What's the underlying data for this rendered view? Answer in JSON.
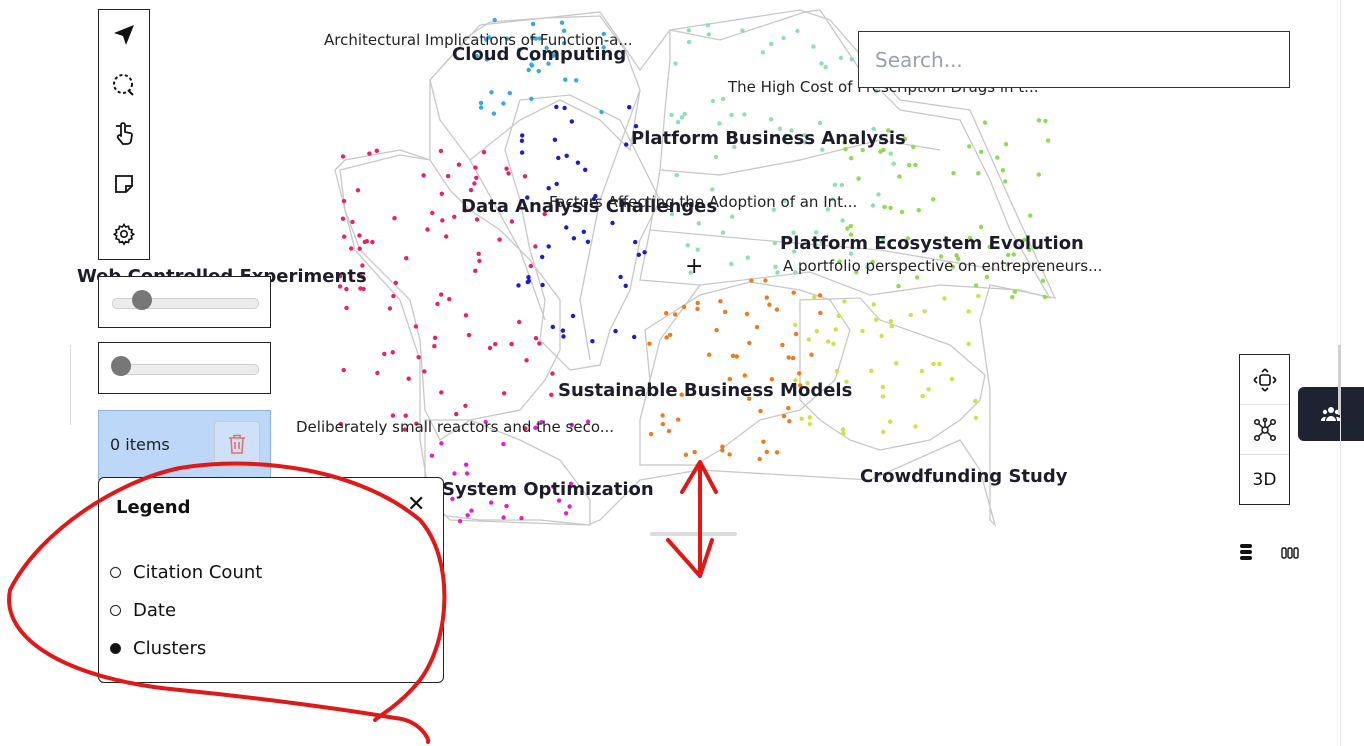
{
  "search": {
    "placeholder": "Search..."
  },
  "clusters": [
    {
      "name": "Cloud Computing",
      "color": "#3aa8e0"
    },
    {
      "name": "Platform Business Analysis",
      "color": "#8ee0b4"
    },
    {
      "name": "Data Analysis Challenges",
      "color": "#1e1ad0"
    },
    {
      "name": "Web Controlled Experiments",
      "color": "#e8206a"
    },
    {
      "name": "Platform Ecosystem Evolution",
      "color": "#8ddb4f"
    },
    {
      "name": "Sustainable Business Models",
      "color": "#ee7a1e"
    },
    {
      "name": "Crowdfunding Study",
      "color": "#cfe04a"
    },
    {
      "name": "System Optimization",
      "color": "#e01fd0"
    }
  ],
  "paper_labels": [
    "Architectural Implications of Function-a...",
    "The High Cost of Prescription Drugs in t...",
    "Factors Affecting the Adoption of an Int...",
    "A portfolio perspective on entrepreneurs...",
    "Deliberately small reactors and the seco..."
  ],
  "crosshair": "+",
  "toolbar": {
    "tools": [
      "navigate-arrow-icon",
      "lasso-search-icon",
      "hand-pointer-icon",
      "sticky-note-icon",
      "gear-icon"
    ]
  },
  "sliders": [
    {
      "name": "slider-1",
      "value": 0.2
    },
    {
      "name": "slider-2",
      "value": 0.0
    }
  ],
  "selection": {
    "count_text": "0 items",
    "trash_icon": "trash-icon"
  },
  "legend": {
    "title": "Legend",
    "close": "✕",
    "options": [
      {
        "label": "Citation Count",
        "selected": false
      },
      {
        "label": "Date",
        "selected": false
      },
      {
        "label": "Clusters",
        "selected": true
      }
    ]
  },
  "view_controls": {
    "rotate_icon": "rotate-view-icon",
    "network_icon": "network-icon",
    "three_d": "3D"
  },
  "side_tab": {
    "icon": "people-icon"
  },
  "layout_icons": [
    "list-view-icon",
    "grid-view-icon"
  ],
  "colors": {
    "accent_dark": "#1e2331",
    "selection_bg": "#bcd7f8",
    "annotation": "#e01818",
    "edge": "#c8c8c8"
  }
}
